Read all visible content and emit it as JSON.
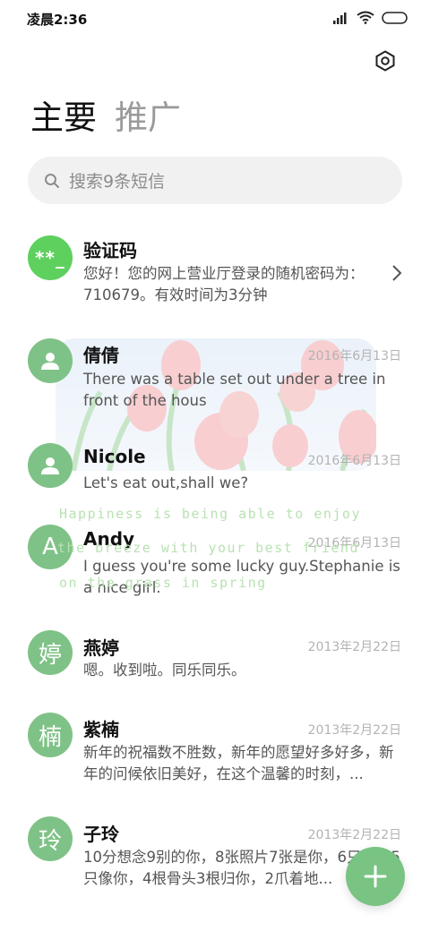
{
  "status_bar": {
    "time": "凌晨2:36"
  },
  "tabs": [
    {
      "label": "主要"
    },
    {
      "label": "推广"
    }
  ],
  "search": {
    "placeholder": "搜索9条短信"
  },
  "conversations": [
    {
      "avatar": "**_",
      "name": "验证码",
      "date": "",
      "preview": "您好！您的网上营业厅登录的随机密码为：710679。有效时间为3分钟"
    },
    {
      "avatar": "person-icon",
      "name": "倩倩",
      "date": "2016年6月13日",
      "preview": "There was a table set out under a tree in front of the hous"
    },
    {
      "avatar": "person-icon",
      "name": "Nicole",
      "date": "2016年6月13日",
      "preview": "Let's eat out,shall we?"
    },
    {
      "avatar": "A",
      "name": "Andy",
      "date": "2016年6月13日",
      "preview": "I guess you're some lucky guy.Stephanie is a nice girl."
    },
    {
      "avatar": "婷",
      "name": "燕婷",
      "date": "2013年2月22日",
      "preview": "嗯。收到啦。同乐同乐。"
    },
    {
      "avatar": "楠",
      "name": "紫楠",
      "date": "2013年2月22日",
      "preview": "新年的祝福数不胜数，新年的愿望好多好多，新年的问候依旧美好，在这个温馨的时刻，..."
    },
    {
      "avatar": "玲",
      "name": "子玲",
      "date": "2013年2月22日",
      "preview": "10分想念9别的你，8张照片7张是你，6只小狗5只像你，4根骨头3根归你，2爪着地..."
    }
  ],
  "watermark": {
    "lines": [
      "Happiness is being able to enjoy",
      "the breeze with your best friend",
      "on the grass in spring"
    ]
  },
  "colors": {
    "avatar": "#7fc287",
    "code_avatar": "#5ed05e",
    "fab": "#79c383"
  }
}
